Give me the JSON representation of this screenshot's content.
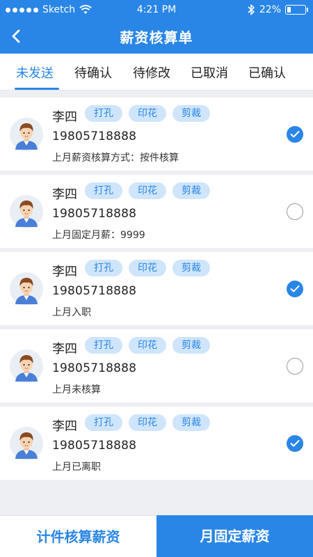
{
  "status_bar": {
    "carrier": "Sketch",
    "time": "4:21 PM",
    "battery": "22%",
    "battery_level": 0.22
  },
  "nav": {
    "title": "薪资核算单",
    "back_icon": "chevron-left-icon"
  },
  "tabs": [
    {
      "label": "未发送",
      "active": true
    },
    {
      "label": "待确认",
      "active": false
    },
    {
      "label": "待修改",
      "active": false
    },
    {
      "label": "已取消",
      "active": false
    },
    {
      "label": "已确认",
      "active": false
    }
  ],
  "employees": [
    {
      "name": "李四",
      "tags": [
        "打孔",
        "印花",
        "剪裁"
      ],
      "phone": "19805718888",
      "note": "上月薪资核算方式：按件核算",
      "checked": true
    },
    {
      "name": "李四",
      "tags": [
        "打孔",
        "印花",
        "剪裁"
      ],
      "phone": "19805718888",
      "note": "上月固定月薪：9999",
      "checked": false
    },
    {
      "name": "李四",
      "tags": [
        "打孔",
        "印花",
        "剪裁"
      ],
      "phone": "19805718888",
      "note": "上月入职",
      "checked": true
    },
    {
      "name": "李四",
      "tags": [
        "打孔",
        "印花",
        "剪裁"
      ],
      "phone": "19805718888",
      "note": "上月未核算",
      "checked": false
    },
    {
      "name": "李四",
      "tags": [
        "打孔",
        "印花",
        "剪裁"
      ],
      "phone": "19805718888",
      "note": "上月已离职",
      "checked": true
    }
  ],
  "bottom_bar": {
    "left_label": "计件核算薪资",
    "right_label": "月固定薪资"
  },
  "colors": {
    "accent": "#2a86e6",
    "tag_bg": "#cfe5fb",
    "page_bg": "#eeeff3"
  }
}
